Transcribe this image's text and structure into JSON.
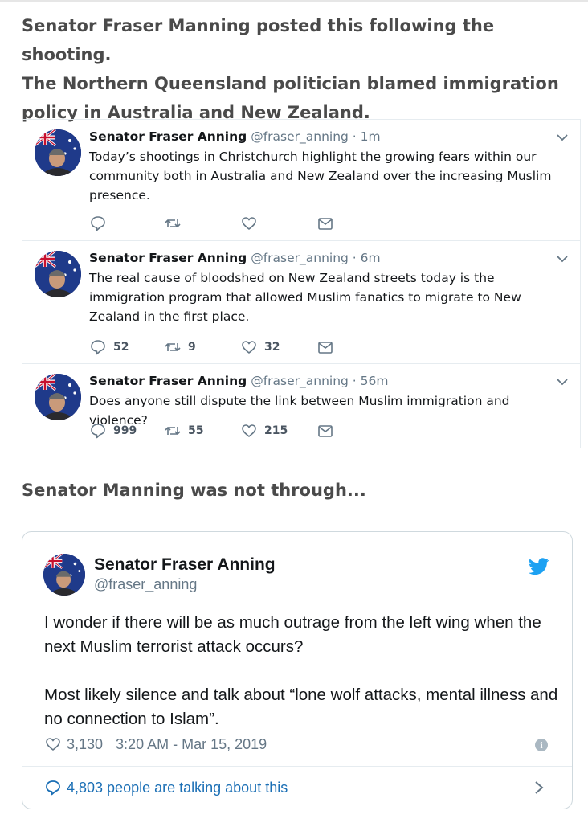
{
  "intro": {
    "line1": "Senator Fraser Manning posted this following the shooting.",
    "line2": "The Northern Queensland politician blamed immigration policy in Australia and New Zealand."
  },
  "tweets": [
    {
      "name": "Senator Fraser Anning",
      "meta": "@fraser_anning · 1m",
      "text": "Today’s shootings in Christchurch highlight the growing fears within our community both in Australia and New Zealand over the increasing Muslim presence.",
      "replies": "",
      "retweets": "",
      "likes": ""
    },
    {
      "name": "Senator Fraser Anning",
      "meta": "@fraser_anning · 6m",
      "text": "The real cause of bloodshed on New Zealand streets today is the immigration program that allowed Muslim fanatics to migrate to New Zealand in the first place.",
      "replies": "52",
      "retweets": "9",
      "likes": "32"
    },
    {
      "name": "Senator Fraser Anning",
      "meta": "@fraser_anning · 56m",
      "text": "Does anyone still dispute the link between Muslim immigration and violence?",
      "replies": "999",
      "retweets": "55",
      "likes": "215"
    }
  ],
  "mid_text": "Senator Manning was not through...",
  "embed": {
    "name": "Senator Fraser Anning",
    "handle": "@fraser_anning",
    "para1": "I wonder if there will be as much outrage from the left wing when the next Muslim terrorist attack occurs?",
    "para2": "Most likely silence and talk about “lone wolf attacks, mental illness and no connection to Islam”.",
    "likes": "3,130",
    "timestamp": "3:20 AM - Mar 15, 2019",
    "talking": "4,803 people are talking about this"
  },
  "colors": {
    "twitter_blue": "#1da1f2",
    "link_blue": "#1b6fb5",
    "muted": "#657786"
  },
  "icons": [
    "reply-icon",
    "retweet-icon",
    "like-icon",
    "dm-icon",
    "chevron-down-icon",
    "twitter-bird-icon",
    "info-icon",
    "comment-icon",
    "chevron-right-icon"
  ]
}
